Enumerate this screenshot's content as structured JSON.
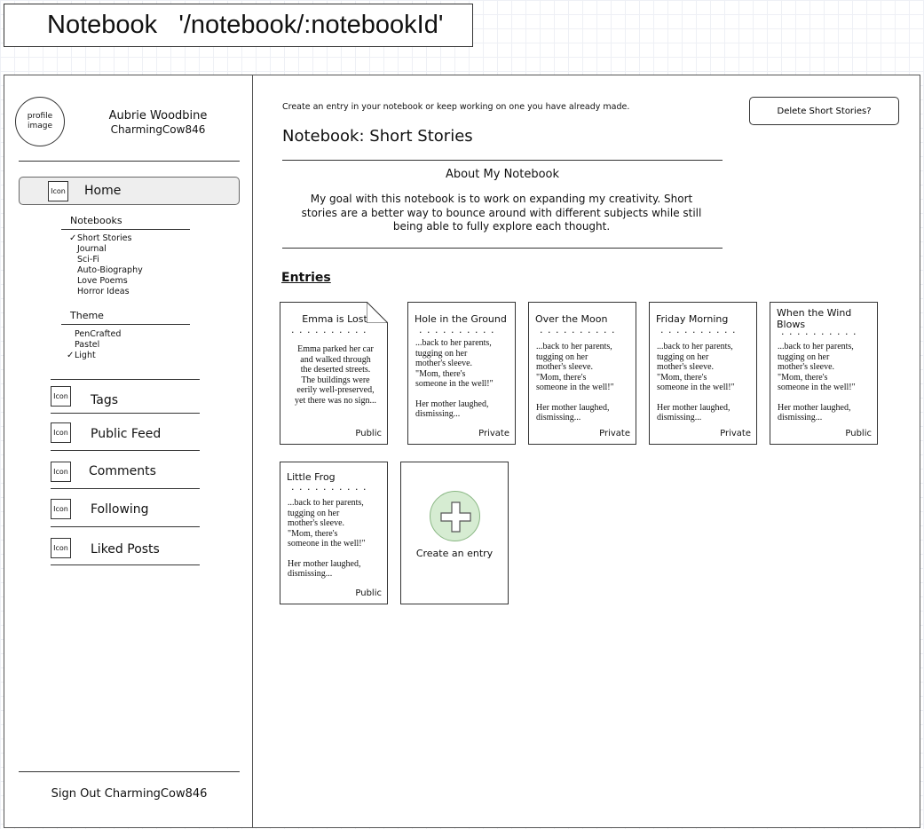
{
  "route_title": "Notebook   '/notebook/:notebookId'",
  "user": {
    "avatar_text": "profile image",
    "name": "Aubrie Woodbine",
    "handle": "CharmingCow846"
  },
  "sidebar": {
    "home_icon": "Icon",
    "home_label": "Home",
    "notebooks_label": "Notebooks",
    "notebooks": [
      {
        "label": "Short Stories",
        "checked": true
      },
      {
        "label": "Journal",
        "checked": false
      },
      {
        "label": "Sci-Fi",
        "checked": false
      },
      {
        "label": "Auto-Biography",
        "checked": false
      },
      {
        "label": "Love Poems",
        "checked": false
      },
      {
        "label": "Horror Ideas",
        "checked": false
      }
    ],
    "theme_label": "Theme",
    "themes": [
      {
        "label": "PenCrafted",
        "checked": false
      },
      {
        "label": "Pastel",
        "checked": false
      },
      {
        "label": "Light",
        "checked": true
      }
    ],
    "check_mark": "✓",
    "nav": [
      {
        "icon": "Icon",
        "label": "Tags"
      },
      {
        "icon": "Icon",
        "label": "Public Feed"
      },
      {
        "icon": "Icon",
        "label": "Comments"
      },
      {
        "icon": "Icon",
        "label": "Following"
      },
      {
        "icon": "Icon",
        "label": "Liked Posts"
      }
    ],
    "sign_out": "Sign Out CharmingCow846"
  },
  "main": {
    "tagline": "Create an entry in your notebook or keep working on one you have already made.",
    "delete_button": "Delete Short Stories?",
    "title": "Notebook: Short Stories",
    "about_title": "About My Notebook",
    "about_text": "My goal with this notebook is to work on expanding my creativity.  Short stories are a better way to bounce around with different subjects while still being able to fully explore each thought.",
    "entries_heading": "Entries",
    "dots": "· · · · · · · · · · · · ·",
    "entries": [
      {
        "title": "Emma is Lost",
        "excerpt_lines": [
          "Emma parked her car",
          "and walked through",
          "the deserted streets.",
          "The buildings were",
          "eerily well-preserved,",
          "yet there was no sign..."
        ],
        "visibility": "Public"
      },
      {
        "title": "Hole in the Ground",
        "excerpt_lines": [
          "...back to her parents,",
          "tugging on her",
          "mother's sleeve.",
          "\"Mom, there's",
          "someone in the well!\"",
          "",
          "Her mother laughed,",
          "dismissing..."
        ],
        "visibility": "Private"
      },
      {
        "title": "Over the Moon",
        "excerpt_lines": [
          "...back to her parents,",
          "tugging on her",
          "mother's sleeve.",
          "\"Mom, there's",
          "someone in the well!\"",
          "",
          "Her mother laughed,",
          "dismissing..."
        ],
        "visibility": "Private"
      },
      {
        "title": "Friday Morning",
        "excerpt_lines": [
          "...back to her parents,",
          "tugging on her",
          "mother's sleeve.",
          "\"Mom, there's",
          "someone in the well!\"",
          "",
          "Her mother laughed,",
          "dismissing..."
        ],
        "visibility": "Private"
      },
      {
        "title": "When the Wind Blows",
        "excerpt_lines": [
          "...back to her parents,",
          "tugging on her",
          "mother's sleeve.",
          "\"Mom, there's",
          "someone in the well!\"",
          "",
          "Her mother laughed,",
          "dismissing..."
        ],
        "visibility": "Public"
      },
      {
        "title": "Little Frog",
        "excerpt_lines": [
          "...back to her parents,",
          "tugging on her",
          "mother's sleeve.",
          "\"Mom, there's",
          "someone in the well!\"",
          "",
          "Her mother laughed,",
          "dismissing..."
        ],
        "visibility": "Public"
      }
    ],
    "create_entry": "Create an entry"
  },
  "colors": {
    "add_circle_fill": "#d6ecd2",
    "add_circle_stroke": "#8ab784"
  }
}
